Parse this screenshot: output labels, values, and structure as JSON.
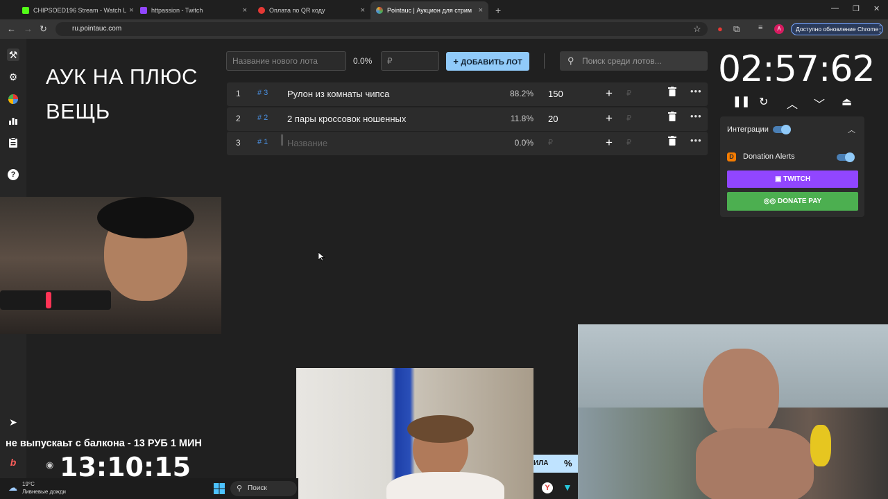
{
  "browser": {
    "tabs": [
      {
        "title": "CHIPSOED196 Stream - Watch L",
        "color": "#53fc18"
      },
      {
        "title": "httpassion - Twitch",
        "color": "#9146ff"
      },
      {
        "title": "Оплата по QR коду",
        "color": "#e53935"
      },
      {
        "title": "Pointauc | Аукцион для стрим",
        "color": "#4a90e2"
      }
    ],
    "url": "ru.pointauc.com",
    "update_label": "Доступно обновление Chrome",
    "profile_initial": "A"
  },
  "auction": {
    "title": "АУК НА ПЛЮС ВЕЩЬ",
    "new_lot_placeholder": "Название нового лота",
    "new_lot_percent": "0.0%",
    "currency": "₽",
    "add_button": "ДОБАВИТЬ ЛОТ",
    "search_placeholder": "Поиск среди лотов...",
    "lots": [
      {
        "pos": "1",
        "id": "# 3",
        "name": "Рулон из комнаты чипса",
        "percent": "88.2%",
        "amount": "150"
      },
      {
        "pos": "2",
        "id": "# 2",
        "name": "2 пары кроссовок ношенных",
        "percent": "11.8%",
        "amount": "20"
      },
      {
        "pos": "3",
        "id": "# 1",
        "name": "Название",
        "percent": "0.0%",
        "amount": "₽"
      }
    ]
  },
  "timer": {
    "value": "02:57:62"
  },
  "integrations": {
    "label": "Интеграции",
    "donation_alerts": "Donation Alerts",
    "twitch_button": "TWITCH",
    "donatepay_button": "DONATE PAY"
  },
  "overlay": {
    "ticker": "не выпускаьт с балкона - 13 РУБ 1 МИН",
    "clock": "13:10:15",
    "side_label": "ИЛА",
    "percent_icon": "%"
  },
  "taskbar": {
    "temperature": "19°C",
    "weather": "Ливневые дожди",
    "search": "Поиск"
  }
}
